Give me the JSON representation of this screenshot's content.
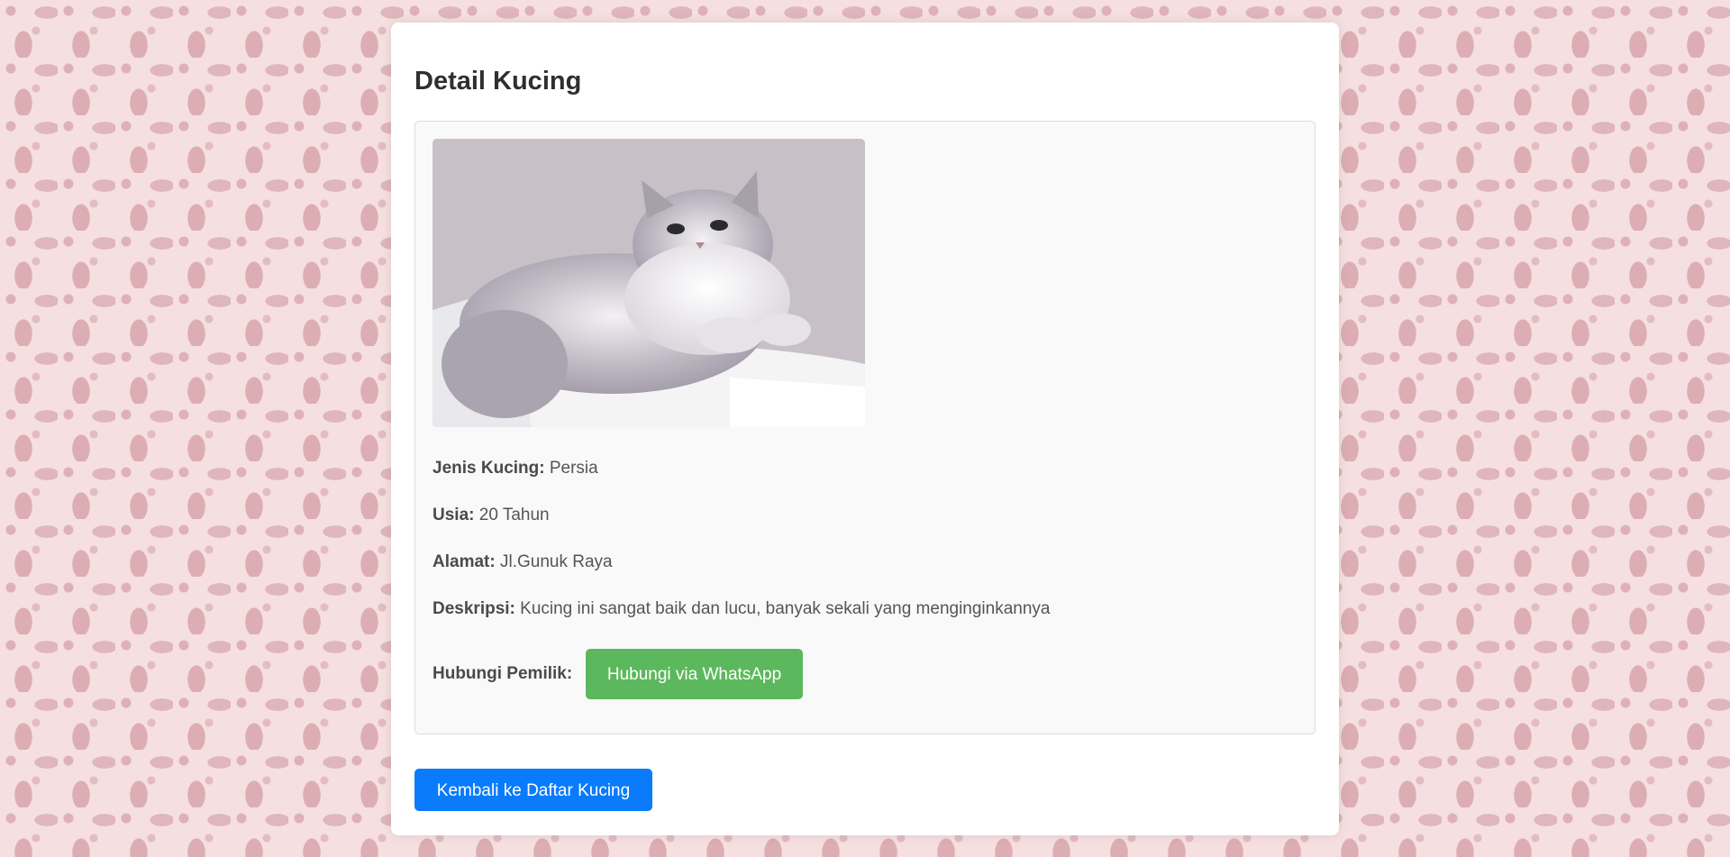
{
  "page": {
    "title": "Detail Kucing"
  },
  "cat": {
    "photo_alt": "Kucing Persia",
    "details": [
      {
        "label": "Jenis Kucing:",
        "value": "Persia"
      },
      {
        "label": "Usia:",
        "value": "20 Tahun"
      },
      {
        "label": "Alamat:",
        "value": "Jl.Gunuk Raya"
      },
      {
        "label": "Deskripsi:",
        "value": "Kucing ini sangat baik dan lucu, banyak sekali yang menginginkannya"
      }
    ],
    "contact_label": "Hubungi Pemilik:",
    "contact_button": "Hubungi via WhatsApp"
  },
  "actions": {
    "back_button": "Kembali ke Daftar Kucing"
  },
  "colors": {
    "whatsapp_green": "#5cb85c",
    "primary_blue": "#0a7bfb",
    "background_pink": "#f6dfe1",
    "pattern_pink": "#ddb1b7"
  }
}
